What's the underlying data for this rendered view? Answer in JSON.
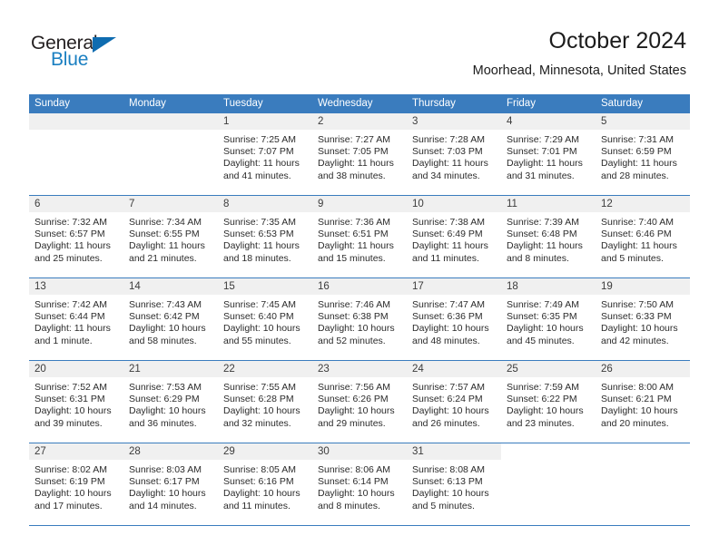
{
  "brand": {
    "line1": "General",
    "line2": "Blue",
    "icon": "triangle-logo-icon"
  },
  "header": {
    "title": "October 2024",
    "location": "Moorhead, Minnesota, United States"
  },
  "weekdays": [
    "Sunday",
    "Monday",
    "Tuesday",
    "Wednesday",
    "Thursday",
    "Friday",
    "Saturday"
  ],
  "labels": {
    "sunrise": "Sunrise:",
    "sunset": "Sunset:",
    "daylight": "Daylight:"
  },
  "colors": {
    "header_blue": "#3a7cbe",
    "brand_blue": "#1a7fc1",
    "daynum_strip": "#f0f0f0",
    "text": "#2b2b2b"
  },
  "weeks": [
    [
      {
        "day": "",
        "empty": true
      },
      {
        "day": "",
        "empty": true
      },
      {
        "day": "1",
        "sunrise": "Sunrise: 7:25 AM",
        "sunset": "Sunset: 7:07 PM",
        "daylight_l1": "Daylight: 11 hours",
        "daylight_l2": "and 41 minutes."
      },
      {
        "day": "2",
        "sunrise": "Sunrise: 7:27 AM",
        "sunset": "Sunset: 7:05 PM",
        "daylight_l1": "Daylight: 11 hours",
        "daylight_l2": "and 38 minutes."
      },
      {
        "day": "3",
        "sunrise": "Sunrise: 7:28 AM",
        "sunset": "Sunset: 7:03 PM",
        "daylight_l1": "Daylight: 11 hours",
        "daylight_l2": "and 34 minutes."
      },
      {
        "day": "4",
        "sunrise": "Sunrise: 7:29 AM",
        "sunset": "Sunset: 7:01 PM",
        "daylight_l1": "Daylight: 11 hours",
        "daylight_l2": "and 31 minutes."
      },
      {
        "day": "5",
        "sunrise": "Sunrise: 7:31 AM",
        "sunset": "Sunset: 6:59 PM",
        "daylight_l1": "Daylight: 11 hours",
        "daylight_l2": "and 28 minutes."
      }
    ],
    [
      {
        "day": "6",
        "sunrise": "Sunrise: 7:32 AM",
        "sunset": "Sunset: 6:57 PM",
        "daylight_l1": "Daylight: 11 hours",
        "daylight_l2": "and 25 minutes."
      },
      {
        "day": "7",
        "sunrise": "Sunrise: 7:34 AM",
        "sunset": "Sunset: 6:55 PM",
        "daylight_l1": "Daylight: 11 hours",
        "daylight_l2": "and 21 minutes."
      },
      {
        "day": "8",
        "sunrise": "Sunrise: 7:35 AM",
        "sunset": "Sunset: 6:53 PM",
        "daylight_l1": "Daylight: 11 hours",
        "daylight_l2": "and 18 minutes."
      },
      {
        "day": "9",
        "sunrise": "Sunrise: 7:36 AM",
        "sunset": "Sunset: 6:51 PM",
        "daylight_l1": "Daylight: 11 hours",
        "daylight_l2": "and 15 minutes."
      },
      {
        "day": "10",
        "sunrise": "Sunrise: 7:38 AM",
        "sunset": "Sunset: 6:49 PM",
        "daylight_l1": "Daylight: 11 hours",
        "daylight_l2": "and 11 minutes."
      },
      {
        "day": "11",
        "sunrise": "Sunrise: 7:39 AM",
        "sunset": "Sunset: 6:48 PM",
        "daylight_l1": "Daylight: 11 hours",
        "daylight_l2": "and 8 minutes."
      },
      {
        "day": "12",
        "sunrise": "Sunrise: 7:40 AM",
        "sunset": "Sunset: 6:46 PM",
        "daylight_l1": "Daylight: 11 hours",
        "daylight_l2": "and 5 minutes."
      }
    ],
    [
      {
        "day": "13",
        "sunrise": "Sunrise: 7:42 AM",
        "sunset": "Sunset: 6:44 PM",
        "daylight_l1": "Daylight: 11 hours",
        "daylight_l2": "and 1 minute."
      },
      {
        "day": "14",
        "sunrise": "Sunrise: 7:43 AM",
        "sunset": "Sunset: 6:42 PM",
        "daylight_l1": "Daylight: 10 hours",
        "daylight_l2": "and 58 minutes."
      },
      {
        "day": "15",
        "sunrise": "Sunrise: 7:45 AM",
        "sunset": "Sunset: 6:40 PM",
        "daylight_l1": "Daylight: 10 hours",
        "daylight_l2": "and 55 minutes."
      },
      {
        "day": "16",
        "sunrise": "Sunrise: 7:46 AM",
        "sunset": "Sunset: 6:38 PM",
        "daylight_l1": "Daylight: 10 hours",
        "daylight_l2": "and 52 minutes."
      },
      {
        "day": "17",
        "sunrise": "Sunrise: 7:47 AM",
        "sunset": "Sunset: 6:36 PM",
        "daylight_l1": "Daylight: 10 hours",
        "daylight_l2": "and 48 minutes."
      },
      {
        "day": "18",
        "sunrise": "Sunrise: 7:49 AM",
        "sunset": "Sunset: 6:35 PM",
        "daylight_l1": "Daylight: 10 hours",
        "daylight_l2": "and 45 minutes."
      },
      {
        "day": "19",
        "sunrise": "Sunrise: 7:50 AM",
        "sunset": "Sunset: 6:33 PM",
        "daylight_l1": "Daylight: 10 hours",
        "daylight_l2": "and 42 minutes."
      }
    ],
    [
      {
        "day": "20",
        "sunrise": "Sunrise: 7:52 AM",
        "sunset": "Sunset: 6:31 PM",
        "daylight_l1": "Daylight: 10 hours",
        "daylight_l2": "and 39 minutes."
      },
      {
        "day": "21",
        "sunrise": "Sunrise: 7:53 AM",
        "sunset": "Sunset: 6:29 PM",
        "daylight_l1": "Daylight: 10 hours",
        "daylight_l2": "and 36 minutes."
      },
      {
        "day": "22",
        "sunrise": "Sunrise: 7:55 AM",
        "sunset": "Sunset: 6:28 PM",
        "daylight_l1": "Daylight: 10 hours",
        "daylight_l2": "and 32 minutes."
      },
      {
        "day": "23",
        "sunrise": "Sunrise: 7:56 AM",
        "sunset": "Sunset: 6:26 PM",
        "daylight_l1": "Daylight: 10 hours",
        "daylight_l2": "and 29 minutes."
      },
      {
        "day": "24",
        "sunrise": "Sunrise: 7:57 AM",
        "sunset": "Sunset: 6:24 PM",
        "daylight_l1": "Daylight: 10 hours",
        "daylight_l2": "and 26 minutes."
      },
      {
        "day": "25",
        "sunrise": "Sunrise: 7:59 AM",
        "sunset": "Sunset: 6:22 PM",
        "daylight_l1": "Daylight: 10 hours",
        "daylight_l2": "and 23 minutes."
      },
      {
        "day": "26",
        "sunrise": "Sunrise: 8:00 AM",
        "sunset": "Sunset: 6:21 PM",
        "daylight_l1": "Daylight: 10 hours",
        "daylight_l2": "and 20 minutes."
      }
    ],
    [
      {
        "day": "27",
        "sunrise": "Sunrise: 8:02 AM",
        "sunset": "Sunset: 6:19 PM",
        "daylight_l1": "Daylight: 10 hours",
        "daylight_l2": "and 17 minutes."
      },
      {
        "day": "28",
        "sunrise": "Sunrise: 8:03 AM",
        "sunset": "Sunset: 6:17 PM",
        "daylight_l1": "Daylight: 10 hours",
        "daylight_l2": "and 14 minutes."
      },
      {
        "day": "29",
        "sunrise": "Sunrise: 8:05 AM",
        "sunset": "Sunset: 6:16 PM",
        "daylight_l1": "Daylight: 10 hours",
        "daylight_l2": "and 11 minutes."
      },
      {
        "day": "30",
        "sunrise": "Sunrise: 8:06 AM",
        "sunset": "Sunset: 6:14 PM",
        "daylight_l1": "Daylight: 10 hours",
        "daylight_l2": "and 8 minutes."
      },
      {
        "day": "31",
        "sunrise": "Sunrise: 8:08 AM",
        "sunset": "Sunset: 6:13 PM",
        "daylight_l1": "Daylight: 10 hours",
        "daylight_l2": "and 5 minutes."
      },
      {
        "day": "",
        "empty": true,
        "noStrip": true
      },
      {
        "day": "",
        "empty": true,
        "noStrip": true
      }
    ]
  ]
}
